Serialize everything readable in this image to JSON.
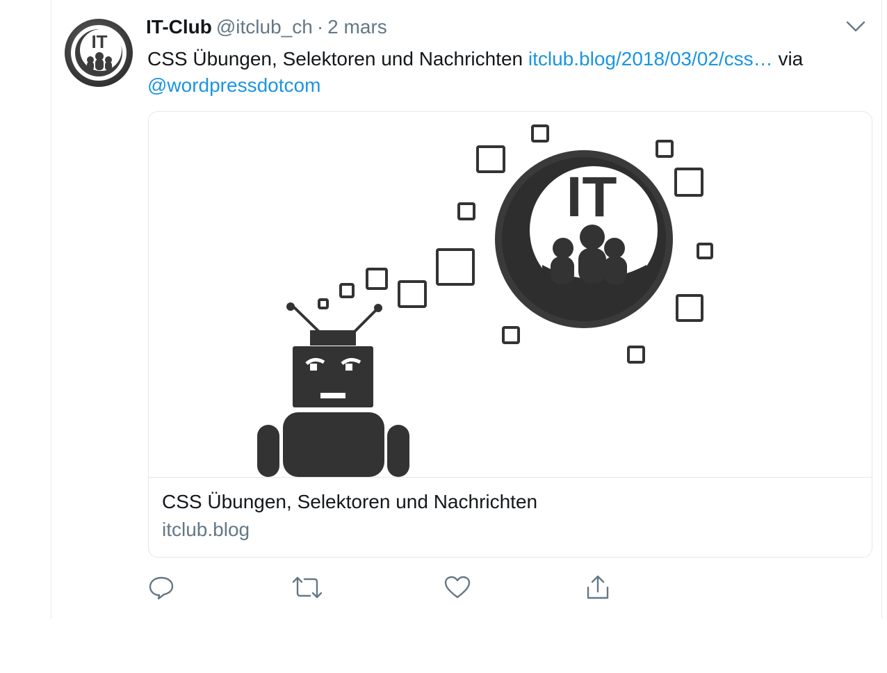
{
  "tweet": {
    "author": {
      "name": "IT-Club",
      "handle": "@itclub_ch",
      "separator": "·",
      "time": "2 mars",
      "avatar_text": "IT"
    },
    "text": {
      "body": "CSS Übungen, Selektoren und Nachrichten",
      "link": "itclub.blog/2018/03/02/css…",
      "via": "via",
      "mention": "@wordpressdotcom"
    },
    "card": {
      "image_text": "IT",
      "title": "CSS Übungen, Selektoren und Nachrichten",
      "domain": "itclub.blog"
    },
    "actions": [
      {
        "name": "reply",
        "icon": "reply-icon"
      },
      {
        "name": "retweet",
        "icon": "retweet-icon"
      },
      {
        "name": "like",
        "icon": "heart-icon"
      },
      {
        "name": "share",
        "icon": "share-icon"
      }
    ],
    "colors": {
      "link": "#1b95e0",
      "secondary_text": "#657786",
      "icon": "#657786",
      "border": "#e1e8ed"
    }
  }
}
